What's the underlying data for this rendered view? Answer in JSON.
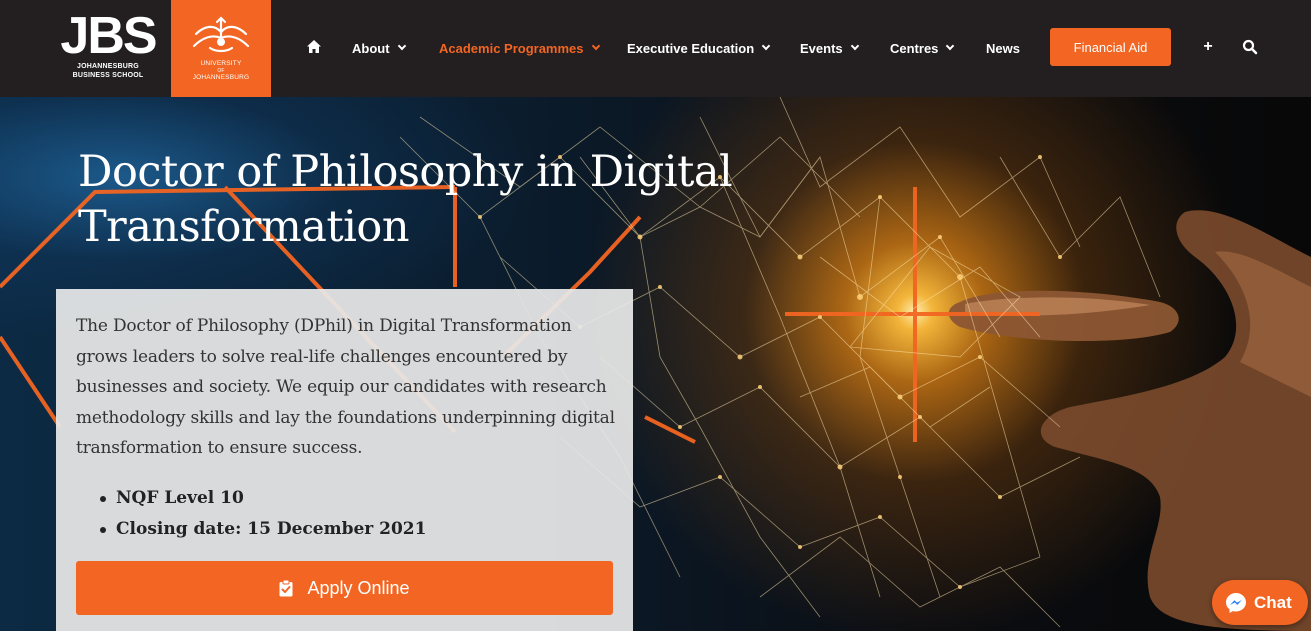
{
  "header": {
    "logo": {
      "mark": "JBS",
      "line1": "JOHANNESBURG",
      "line2": "BUSINESS SCHOOL"
    },
    "uj_logo": {
      "line1": "UNIVERSITY",
      "line2": "OF",
      "line3": "JOHANNESBURG"
    },
    "nav": [
      {
        "label": "About",
        "dropdown": true
      },
      {
        "label": "Academic Programmes",
        "dropdown": true,
        "active": true
      },
      {
        "label": "Executive Education",
        "dropdown": true
      },
      {
        "label": "Events",
        "dropdown": true
      },
      {
        "label": "Centres",
        "dropdown": true
      },
      {
        "label": "News",
        "dropdown": false
      }
    ],
    "cta_label": "Financial Aid",
    "plus_label": "+",
    "icons": [
      "home-icon",
      "plus-icon",
      "search-icon"
    ]
  },
  "hero": {
    "title_line1": "Doctor of Philosophy in Digital",
    "title_line2": "Transformation",
    "description": "The Doctor of Philosophy (DPhil) in Digital Transformation grows leaders to solve real-life challenges encountered by businesses and society. We equip our candidates with research methodology skills and lay the foundations underpinning digital transformation to ensure success.",
    "bullets": [
      "NQF Level 10",
      "Closing date: 15 December 2021"
    ],
    "apply_label": "Apply Online"
  },
  "chat": {
    "label": "Chat"
  },
  "colors": {
    "accent": "#f26522",
    "header_bg": "#231f20",
    "card_bg": "#e8e8e8"
  }
}
